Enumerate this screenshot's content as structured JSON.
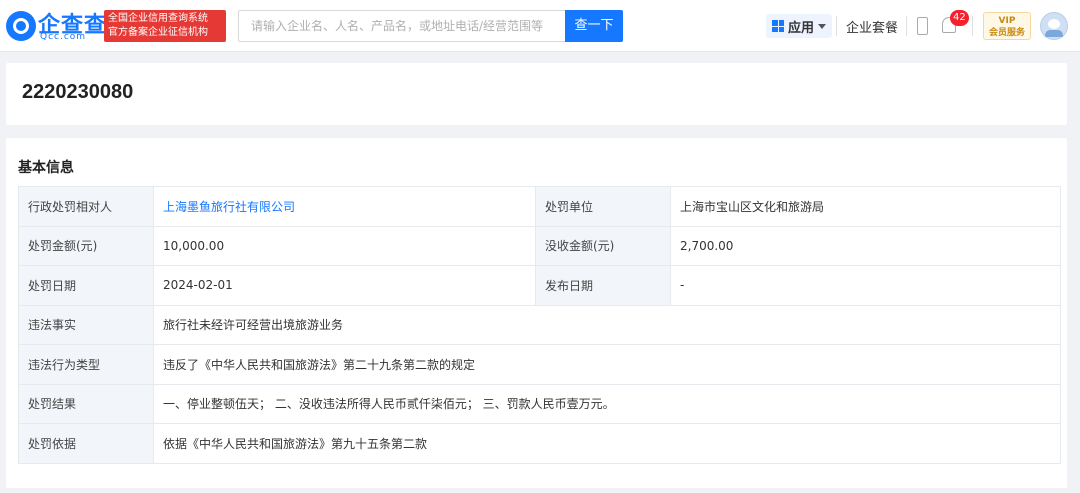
{
  "header": {
    "logo_text": "企查查",
    "logo_sub": "Qcc.com",
    "badge_line1": "全国企业信用查询系统",
    "badge_line2": "官方备案企业征信机构",
    "search_placeholder": "请输入企业名、人名、产品名，或地址电话/经营范围等",
    "search_button": "查一下",
    "apps_label": "应用",
    "package_label": "企业套餐",
    "notification_count": "42",
    "vip_top": "VIP",
    "vip_bottom": "会员服务"
  },
  "record": {
    "id": "2220230080"
  },
  "basic_info": {
    "title": "基本信息",
    "rows": [
      {
        "label1": "行政处罚相对人",
        "value1": "上海墨鱼旅行社有限公司",
        "label2": "处罚单位",
        "value2": "上海市宝山区文化和旅游局"
      },
      {
        "label1": "处罚金额(元)",
        "value1": "10,000.00",
        "label2": "没收金额(元)",
        "value2": "2,700.00"
      },
      {
        "label1": "处罚日期",
        "value1": "2024-02-01",
        "label2": "发布日期",
        "value2": "-"
      }
    ],
    "full_rows": [
      {
        "label": "违法事实",
        "value": "旅行社未经许可经营出境旅游业务"
      },
      {
        "label": "违法行为类型",
        "value": "违反了《中华人民共和国旅游法》第二十九条第二款的规定"
      },
      {
        "label": "处罚结果",
        "value": "一、停业整顿伍天； 二、没收违法所得人民币贰仟柒佰元； 三、罚款人民币壹万元。"
      },
      {
        "label": "处罚依据",
        "value": "依据《中华人民共和国旅游法》第九十五条第二款"
      }
    ]
  },
  "colors": {
    "brand_blue": "#1677ff",
    "badge_red": "#e53935",
    "label_bg": "#f2f6fb"
  }
}
